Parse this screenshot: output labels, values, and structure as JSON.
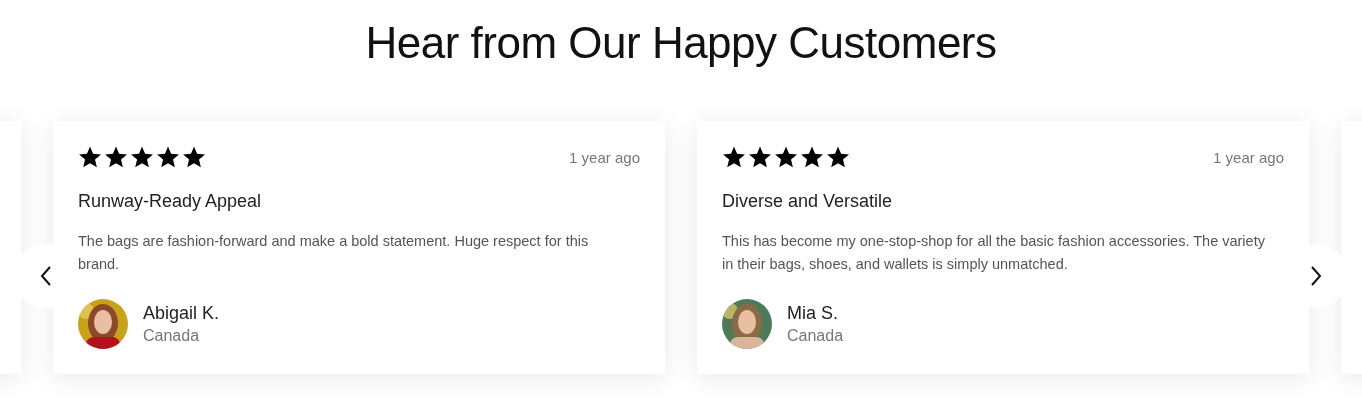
{
  "title": "Hear from Our Happy Customers",
  "reviews": [
    {
      "stars": 5,
      "time": "1 year ago",
      "headline": "Runway-Ready Appeal",
      "body": "The bags are fashion-forward and make a bold statement. Huge respect for this brand.",
      "name": "Abigail K.",
      "location": "Canada"
    },
    {
      "stars": 5,
      "time": "1 year ago",
      "headline": "Diverse and Versatile",
      "body": "This has become my one-stop-shop for all the basic fashion accessories. The variety in their bags, shoes, and wallets is simply unmatched.",
      "name": "Mia S.",
      "location": "Canada"
    }
  ]
}
